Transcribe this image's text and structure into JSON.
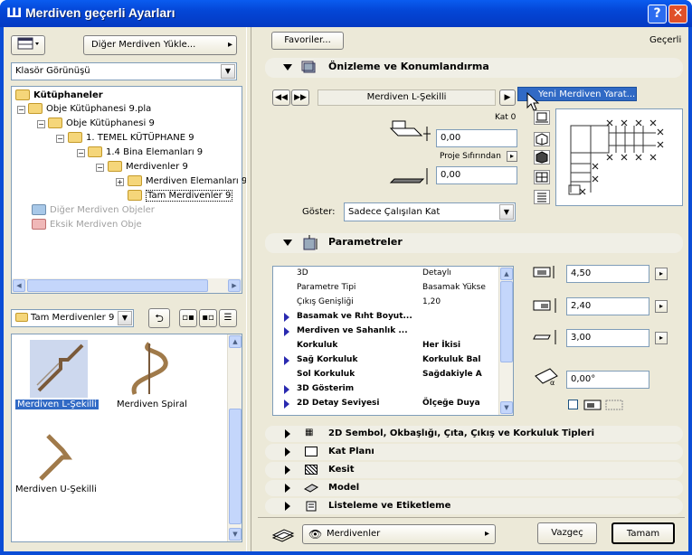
{
  "window": {
    "title": "Merdiven geçerli Ayarları",
    "help": "?",
    "close": "✕"
  },
  "left": {
    "load_button": "Diğer Merdiven Yükle...",
    "view_mode": "Klasör Görünüşü",
    "tree": [
      "Kütüphaneler",
      "Obje Kütüphanesi 9.pla",
      "Obje Kütüphanesi 9",
      "1. TEMEL KÜTÜPHANE 9",
      "1.4 Bina Elemanları 9",
      "Merdivenler 9",
      "Merdiven Elemanları 9",
      "Tam Merdivenler 9",
      "Diğer Merdiven Objeler",
      "Eksik Merdiven Obje"
    ],
    "folder_select": "Tam Merdivenler 9",
    "items": [
      "Merdiven L-Şekilli",
      "Merdiven Spiral",
      "Merdiven U-Şekilli"
    ]
  },
  "right": {
    "favorites": "Favoriler...",
    "current": "Geçerli",
    "preview": {
      "header": "Önizleme ve Konumlandırma",
      "object_name": "Merdiven L-Şekilli",
      "menu_item": "Yeni Merdiven Yarat...",
      "floor_label": "Kat 0",
      "height1": "0,00",
      "proj_label": "Proje Sıfırından",
      "height2": "0,00",
      "show_label": "Göster:",
      "show_value": "Sadece Çalışılan Kat"
    },
    "params": {
      "header": "Parametreler",
      "rows": [
        {
          "k": "3D",
          "v": "Detaylı",
          "bold": false,
          "tri": false
        },
        {
          "k": "Parametre Tipi",
          "v": "Basamak Yükse",
          "bold": false,
          "tri": false
        },
        {
          "k": "Çıkış Genişliği",
          "v": "1,20",
          "bold": false,
          "tri": false
        },
        {
          "k": "Basamak ve Rıht Boyut...",
          "v": "",
          "bold": true,
          "tri": true
        },
        {
          "k": "Merdiven ve Sahanlık ...",
          "v": "",
          "bold": true,
          "tri": true
        },
        {
          "k": "Korkuluk",
          "v": "Her İkisi",
          "bold": true,
          "tri": false
        },
        {
          "k": "Sağ Korkuluk",
          "v": "Korkuluk Bal",
          "bold": true,
          "tri": true
        },
        {
          "k": "Sol Korkuluk",
          "v": "Sağdakiyle A",
          "bold": true,
          "tri": false
        },
        {
          "k": "3D Gösterim",
          "v": "",
          "bold": true,
          "tri": true
        },
        {
          "k": "2D Detay Seviyesi",
          "v": "Ölçeğe Duya",
          "bold": true,
          "tri": true
        }
      ],
      "dim1": "4,50",
      "dim2": "2,40",
      "dim3": "3,00",
      "angle": "0,00°"
    },
    "sections": [
      "2D Sembol, Okbaşlığı, Çıta, Çıkış ve Korkuluk Tipleri",
      "Kat Planı",
      "Kesit",
      "Model",
      "Listeleme ve Etiketleme"
    ],
    "layer": "Merdivenler",
    "cancel": "Vazgeç",
    "ok": "Tamam"
  }
}
